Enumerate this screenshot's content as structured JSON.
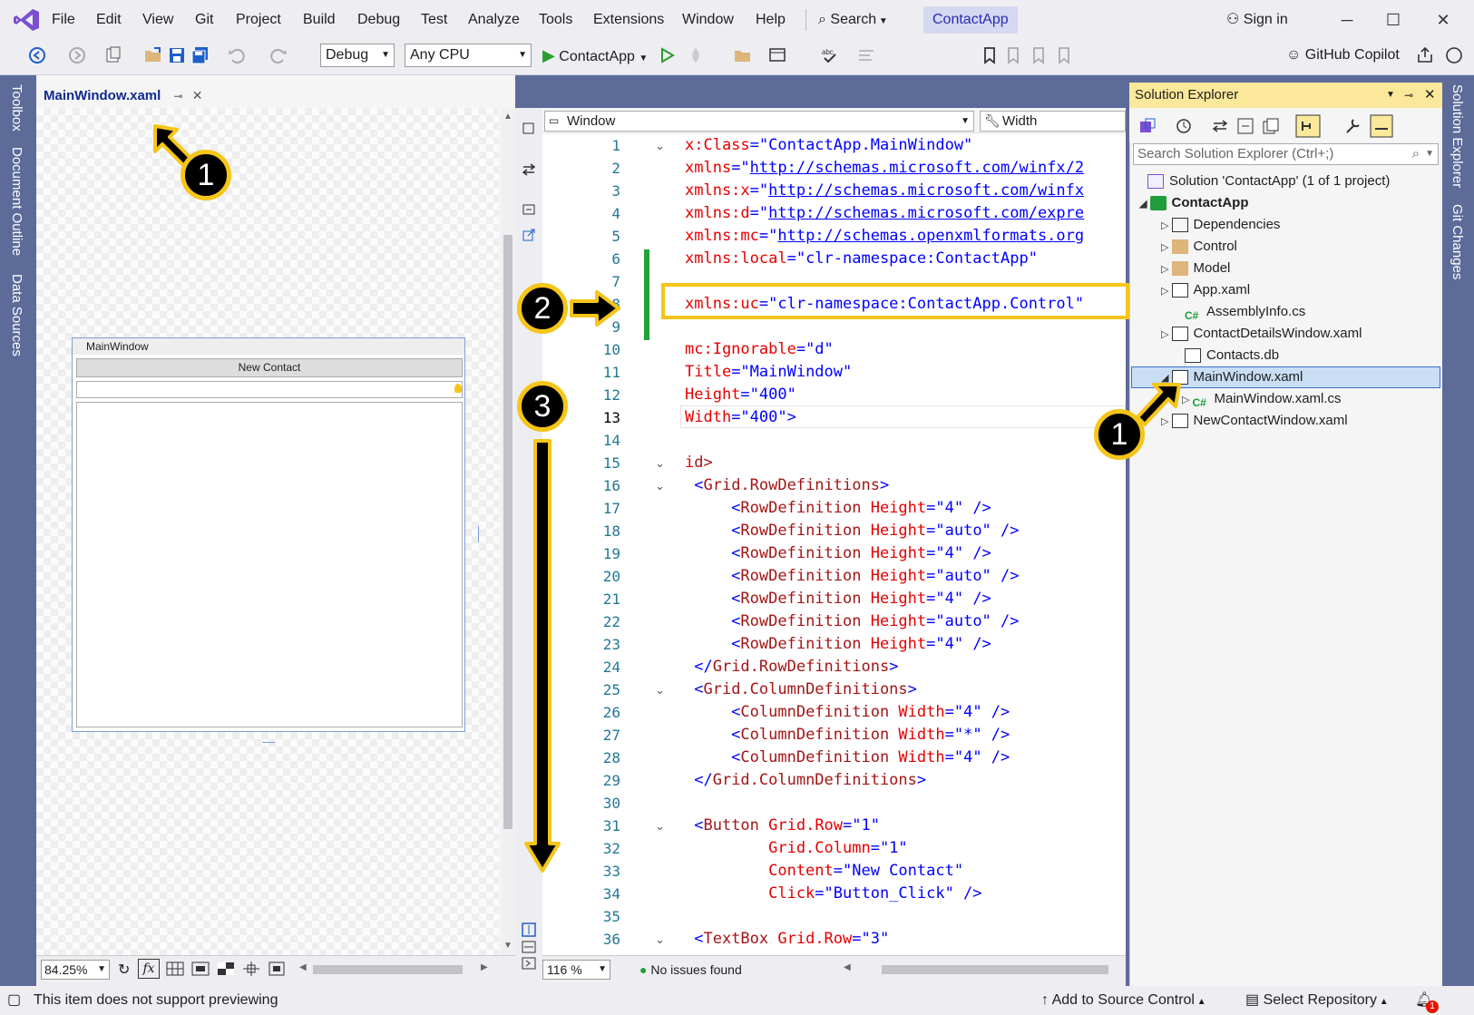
{
  "menubar": {
    "items": [
      "File",
      "Edit",
      "View",
      "Git",
      "Project",
      "Build",
      "Debug",
      "Test",
      "Analyze",
      "Tools",
      "Extensions",
      "Window",
      "Help"
    ],
    "search_label": "Search",
    "app_name": "ContactApp",
    "sign_in": "Sign in"
  },
  "toolbar": {
    "config": "Debug",
    "platform": "Any CPU",
    "run_target": "ContactApp",
    "copilot": "GitHub Copilot"
  },
  "side_tabs_left": [
    "Toolbox",
    "Document Outline",
    "Data Sources"
  ],
  "side_tabs_right": [
    "Solution Explorer",
    "Git Changes"
  ],
  "designer": {
    "tab_title": "MainWindow.xaml",
    "preview_window_title": "MainWindow",
    "preview_button": "New Contact",
    "zoom": "84.25%",
    "fx_label": "fx"
  },
  "editor": {
    "nav_left": "Window",
    "nav_right": "Width",
    "zoom": "116 %",
    "issues": "No issues found",
    "lines": [
      {
        "n": "1",
        "parts": [
          [
            "an",
            "x:Class"
          ],
          [
            "av",
            "=\"ContactApp.MainWindow\""
          ]
        ]
      },
      {
        "n": "2",
        "parts": [
          [
            "an",
            "xmlns"
          ],
          [
            "av",
            "=\""
          ],
          [
            "url",
            "http://schemas.microsoft.com/winfx/2"
          ]
        ]
      },
      {
        "n": "3",
        "parts": [
          [
            "an",
            "xmlns:x"
          ],
          [
            "av",
            "=\""
          ],
          [
            "url",
            "http://schemas.microsoft.com/winfx"
          ]
        ]
      },
      {
        "n": "4",
        "parts": [
          [
            "an",
            "xmlns:d"
          ],
          [
            "av",
            "=\""
          ],
          [
            "url",
            "http://schemas.microsoft.com/expre"
          ]
        ]
      },
      {
        "n": "5",
        "parts": [
          [
            "an",
            "xmlns:mc"
          ],
          [
            "av",
            "=\""
          ],
          [
            "url",
            "http://schemas.openxmlformats.org"
          ]
        ]
      },
      {
        "n": "6",
        "parts": [
          [
            "an",
            "xmlns:local"
          ],
          [
            "av",
            "=\"clr-namespace:ContactApp\""
          ]
        ]
      },
      {
        "n": "7",
        "parts": []
      },
      {
        "n": "8",
        "parts": [
          [
            "an",
            "xmlns:uc"
          ],
          [
            "av",
            "=\"clr-namespace:ContactApp.Control\""
          ]
        ]
      },
      {
        "n": "9",
        "parts": []
      },
      {
        "n": "10",
        "parts": [
          [
            "an",
            "mc:Ignorable"
          ],
          [
            "av",
            "=\"d\""
          ]
        ]
      },
      {
        "n": "11",
        "parts": [
          [
            "an",
            "Title"
          ],
          [
            "av",
            "=\"MainWindow\""
          ]
        ]
      },
      {
        "n": "12",
        "parts": [
          [
            "an",
            "Height"
          ],
          [
            "av",
            "=\"400\""
          ]
        ]
      },
      {
        "n": "13",
        "parts": [
          [
            "an",
            "Width"
          ],
          [
            "av",
            "=\"400\">"
          ]
        ]
      },
      {
        "n": "14",
        "parts": []
      },
      {
        "n": "15",
        "parts": [
          [
            "an",
            "i"
          ],
          [
            "tg",
            "d>"
          ]
        ]
      },
      {
        "n": "16",
        "parts": [
          [
            "av",
            " <"
          ],
          [
            "tg",
            "Grid.RowDefinitions"
          ],
          [
            "av",
            ">"
          ]
        ]
      },
      {
        "n": "17",
        "parts": [
          [
            "av",
            "     <"
          ],
          [
            "tg",
            "RowDefinition"
          ],
          [
            "an",
            " Height"
          ],
          [
            "av",
            "=\"4\" />"
          ]
        ]
      },
      {
        "n": "18",
        "parts": [
          [
            "av",
            "     <"
          ],
          [
            "tg",
            "RowDefinition"
          ],
          [
            "an",
            " Height"
          ],
          [
            "av",
            "=\"auto\" />"
          ]
        ]
      },
      {
        "n": "19",
        "parts": [
          [
            "av",
            "     <"
          ],
          [
            "tg",
            "RowDefinition"
          ],
          [
            "an",
            " Height"
          ],
          [
            "av",
            "=\"4\" />"
          ]
        ]
      },
      {
        "n": "20",
        "parts": [
          [
            "av",
            "     <"
          ],
          [
            "tg",
            "RowDefinition"
          ],
          [
            "an",
            " Height"
          ],
          [
            "av",
            "=\"auto\" />"
          ]
        ]
      },
      {
        "n": "21",
        "parts": [
          [
            "av",
            "     <"
          ],
          [
            "tg",
            "RowDefinition"
          ],
          [
            "an",
            " Height"
          ],
          [
            "av",
            "=\"4\" />"
          ]
        ]
      },
      {
        "n": "22",
        "parts": [
          [
            "av",
            "     <"
          ],
          [
            "tg",
            "RowDefinition"
          ],
          [
            "an",
            " Height"
          ],
          [
            "av",
            "=\"auto\" />"
          ]
        ]
      },
      {
        "n": "23",
        "parts": [
          [
            "av",
            "     <"
          ],
          [
            "tg",
            "RowDefinition"
          ],
          [
            "an",
            " Height"
          ],
          [
            "av",
            "=\"4\" />"
          ]
        ]
      },
      {
        "n": "24",
        "parts": [
          [
            "av",
            " </"
          ],
          [
            "tg",
            "Grid.RowDefinitions"
          ],
          [
            "av",
            ">"
          ]
        ]
      },
      {
        "n": "25",
        "parts": [
          [
            "av",
            " <"
          ],
          [
            "tg",
            "Grid.ColumnDefinitions"
          ],
          [
            "av",
            ">"
          ]
        ]
      },
      {
        "n": "26",
        "parts": [
          [
            "av",
            "     <"
          ],
          [
            "tg",
            "ColumnDefinition"
          ],
          [
            "an",
            " Width"
          ],
          [
            "av",
            "=\"4\" />"
          ]
        ]
      },
      {
        "n": "27",
        "parts": [
          [
            "av",
            "     <"
          ],
          [
            "tg",
            "ColumnDefinition"
          ],
          [
            "an",
            " Width"
          ],
          [
            "av",
            "=\"*\" />"
          ]
        ]
      },
      {
        "n": "28",
        "parts": [
          [
            "av",
            "     <"
          ],
          [
            "tg",
            "ColumnDefinition"
          ],
          [
            "an",
            " Width"
          ],
          [
            "av",
            "=\"4\" />"
          ]
        ]
      },
      {
        "n": "29",
        "parts": [
          [
            "av",
            " </"
          ],
          [
            "tg",
            "Grid.ColumnDefinitions"
          ],
          [
            "av",
            ">"
          ]
        ]
      },
      {
        "n": "30",
        "parts": []
      },
      {
        "n": "31",
        "parts": [
          [
            "av",
            " <"
          ],
          [
            "tg",
            "Button"
          ],
          [
            "an",
            " Grid.Row"
          ],
          [
            "av",
            "=\"1\""
          ]
        ]
      },
      {
        "n": "32",
        "parts": [
          [
            "an",
            "         Grid.Column"
          ],
          [
            "av",
            "=\"1\""
          ]
        ]
      },
      {
        "n": "33",
        "parts": [
          [
            "an",
            "         Content"
          ],
          [
            "av",
            "=\"New Contact\""
          ]
        ]
      },
      {
        "n": "34",
        "parts": [
          [
            "an",
            "         Click"
          ],
          [
            "av",
            "=\"Button_Click\" />"
          ]
        ]
      },
      {
        "n": "35",
        "parts": []
      },
      {
        "n": "36",
        "parts": [
          [
            "av",
            " <"
          ],
          [
            "tg",
            "TextBox"
          ],
          [
            "an",
            " Grid.Row"
          ],
          [
            "av",
            "=\"3\""
          ]
        ]
      }
    ]
  },
  "solution_explorer": {
    "title": "Solution Explorer",
    "search_placeholder": "Search Solution Explorer (Ctrl+;)",
    "solution": "Solution 'ContactApp' (1 of 1 project)",
    "project": "ContactApp",
    "items": [
      "Dependencies",
      "Control",
      "Model",
      "App.xaml",
      "AssemblyInfo.cs",
      "ContactDetailsWindow.xaml",
      "Contacts.db",
      "MainWindow.xaml",
      "MainWindow.xaml.cs",
      "NewContactWindow.xaml"
    ]
  },
  "statusbar": {
    "message": "This item does not support previewing",
    "source_control": "Add to Source Control",
    "repo": "Select Repository",
    "notifications": "1"
  },
  "callouts": [
    "1",
    "2",
    "3",
    "1"
  ],
  "colors": {
    "accent": "#f5c518",
    "chrome": "#eeeef2",
    "frame": "#5d6b99",
    "selection": "#c9def5"
  }
}
